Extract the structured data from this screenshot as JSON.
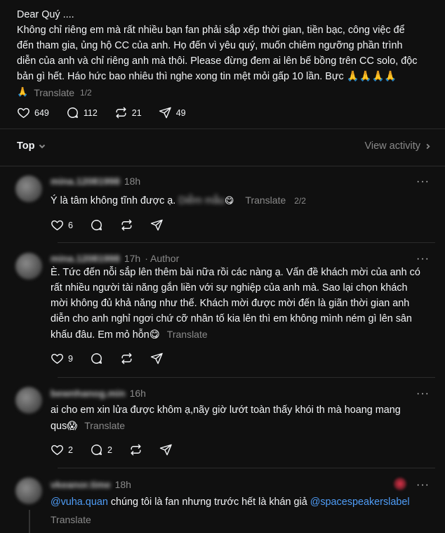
{
  "post": {
    "lines": [
      "Dear Quý ....",
      "Không chỉ riêng em mà rất nhiều bạn fan phải sắp xếp thời gian, tiền bạc, công việc để",
      "đến tham gia, ủng hộ CC của anh. Họ đến vì yêu quý, muốn chiêm ngưỡng phần trình",
      "diễn của anh và chỉ riêng anh mà thôi. Please đừng đem ai lên bế bồng trên CC solo, độc",
      "bản gì hết. Háo hức bao nhiêu thì nghe xong tin mệt mỏi gấp 10 lần. Bực 🙏🙏🙏🙏"
    ],
    "trailing_emoji": "🙏",
    "translate": "Translate",
    "page_indicator": "1/2",
    "likes": "649",
    "comments": "112",
    "reposts": "21",
    "shares": "49"
  },
  "filter": {
    "label": "Top",
    "view_activity": "View activity"
  },
  "replies": [
    {
      "username": "mina.12081998",
      "time": "18h",
      "author": "",
      "text_before": "Ý là tâm không tĩnh được ạ.",
      "blurred": "Diễm mẫu",
      "text_after": " 😋",
      "translate": "Translate",
      "page_indicator": "2/2",
      "likes": "6",
      "comments": "",
      "reposts": ""
    },
    {
      "username": "mina.12081998",
      "time": "17h",
      "author": "· Author",
      "lines": [
        "È. Tức đến nỗi sắp lên thêm bài nữa rồi các nàng ạ. Vấn đề khách mời của anh có",
        "rất nhiều người tài năng gắn liền với sự nghiệp của anh mà. Sao lại chọn khách",
        "mời không đủ khả năng như thế. Khách mời được mời đến là giãn thời gian anh",
        "diễn cho anh nghỉ ngơi chứ cỡ nhân tố kia lên thì em không mình ném gì lên sân",
        "khấu đâu. Em mỏ hỗn😋"
      ],
      "translate": "Translate",
      "likes": "9",
      "comments": "",
      "reposts": ""
    },
    {
      "username": "bewnhanog.min",
      "time": "16h",
      "lines": [
        "ai cho em xin lửa được khôm ạ,nãy giờ lướt toàn thấy khói th mà hoang mang",
        "qus😱"
      ],
      "translate": "Translate",
      "likes": "2",
      "comments": "2",
      "reposts": ""
    },
    {
      "username": "vkeanor.time",
      "time": "18h",
      "mention1": "@vuha.quan",
      "text_mid": " chúng tôi là fan nhưng trước hết là khán giả ",
      "mention2": "@spacespeakerslabel",
      "translate": "Translate"
    }
  ],
  "icons": {
    "like": "heart-icon",
    "comment": "comment-icon",
    "repost": "repost-icon",
    "share": "share-icon",
    "more": "more-icon",
    "chevron": "chevron-down-icon"
  },
  "colors": {
    "background": "#101010",
    "text": "#f3f5f7",
    "muted": "#8a8a8a",
    "mention": "#4f9df7"
  }
}
